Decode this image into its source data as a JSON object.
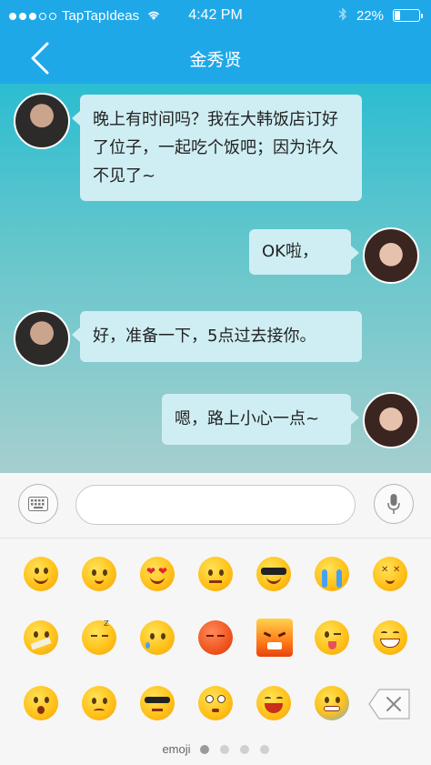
{
  "status_bar": {
    "carrier": "TapTapIdeas",
    "time": "4:42 PM",
    "battery": "22%",
    "battery_level": 0.22,
    "signal_bars": 3,
    "signal_total": 5
  },
  "nav": {
    "title": "金秀贤"
  },
  "messages": [
    {
      "side": "left",
      "text": "晚上有时间吗？我在大韩饭店订好了位子，一起吃个饭吧；因为许久不见了~"
    },
    {
      "side": "right",
      "text": "OK啦，"
    },
    {
      "side": "left",
      "text": "好，准备一下，5点过去接你。"
    },
    {
      "side": "right",
      "text": "嗯，路上小心一点~"
    }
  ],
  "input": {
    "value": "",
    "placeholder": ""
  },
  "emoji_panel": {
    "page_label": "emoji",
    "page_count": 4,
    "current_page": 1,
    "rows": [
      [
        "smile",
        "shy",
        "heart-eyes",
        "annoyed",
        "cool",
        "crying",
        "dizzy"
      ],
      [
        "zipped-mouth",
        "sleepy",
        "tearful",
        "sleeping-red",
        "angry-fire",
        "wink-tongue",
        "grin"
      ],
      [
        "surprised",
        "sad",
        "sunglasses-cool",
        "teary-eyes",
        "laugh",
        "sweat"
      ]
    ]
  },
  "colors": {
    "header": "#1fa8e8",
    "bubble": "#cfeef3",
    "chat_top": "#2bbdd1",
    "chat_bottom": "#a6cfcf"
  }
}
